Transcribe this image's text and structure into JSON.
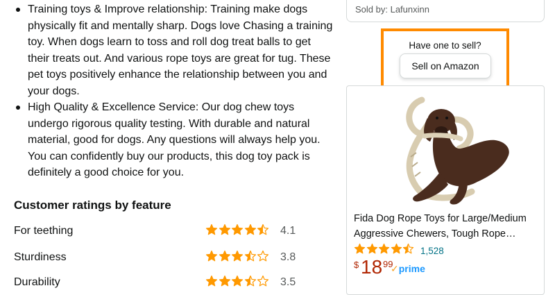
{
  "features": {
    "bullets": [
      "Training toys & Improve relationship: Training make dogs physically fit and mentally sharp. Dogs love Chasing a training toy. When dogs learn to toss and roll dog treat balls to get their treats out. And various rope toys are great for tug. These pet toys positively enhance the relationship between you and your dogs.",
      "High Quality & Excellence Service: Our dog chew toys undergo rigorous quality testing. With durable and natural material, good for dogs. Any questions will always help you. You can confidently buy our products, this dog toy pack is definitely a good choice for you."
    ]
  },
  "ratings": {
    "title": "Customer ratings by feature",
    "rows": [
      {
        "label": "For teething",
        "value": "4.1",
        "stars": 4.5
      },
      {
        "label": "Sturdiness",
        "value": "3.8",
        "stars": 3.5
      },
      {
        "label": "Durability",
        "value": "3.5",
        "stars": 3.5
      }
    ]
  },
  "seller": {
    "sold_by": "Sold by: Lafunxinn"
  },
  "sell_box": {
    "question": "Have one to sell?",
    "button": "Sell on Amazon"
  },
  "ad": {
    "image_icon": "dog-with-rope-toy-image",
    "title": "Fida Dog Rope Toys for Large/Medium Aggressive Chewers, Tough Rope…",
    "stars": 4.5,
    "review_count": "1,528",
    "price_symbol": "$",
    "price_whole": "18",
    "price_fraction": "99",
    "prime_label": "prime"
  },
  "colors": {
    "star": "#ff9900",
    "link": "#007185",
    "price": "#b12704",
    "highlight_border": "#ff8a00",
    "prime": "#1a98ff"
  }
}
